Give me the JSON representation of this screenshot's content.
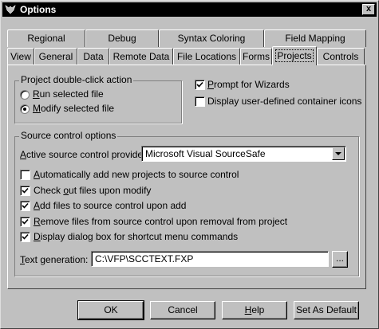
{
  "window": {
    "title": "Options",
    "close_glyph": "x"
  },
  "tabs_row1": [
    "Regional",
    "Debug",
    "Syntax Coloring",
    "Field Mapping"
  ],
  "tabs_row2": [
    "View",
    "General",
    "Data",
    "Remote Data",
    "File Locations",
    "Forms",
    "Projects",
    "Controls"
  ],
  "selected_tab": "Projects",
  "project_action": {
    "label": "Project double-click action",
    "option_run": "Run selected file",
    "option_modify": "Modify selected file",
    "selected": "Modify selected file"
  },
  "prompt_wizards": {
    "label": "Prompt for Wizards",
    "checked": true
  },
  "display_icons": {
    "label": "Display user-defined container icons",
    "checked": false
  },
  "source_control": {
    "label": "Source control options",
    "provider_label": "Active source control provider:",
    "provider_value": "Microsoft Visual SourceSafe",
    "auto_add": {
      "label": "Automatically add new projects to source control",
      "checked": false
    },
    "check_out": {
      "label": "Check out files upon modify",
      "checked": true
    },
    "add_files": {
      "label": "Add files to source control upon add",
      "checked": true
    },
    "remove_files": {
      "label": "Remove files from source control upon removal from project",
      "checked": true
    },
    "display_dialog": {
      "label": "Display dialog box for shortcut menu commands",
      "checked": true
    },
    "text_gen_label": "Text generation:",
    "text_gen_value": "C:\\VFP\\SCCTEXT.FXP",
    "browse_label": "..."
  },
  "buttons": {
    "ok": "OK",
    "cancel": "Cancel",
    "help": "Help",
    "set_default": "Set As Default"
  }
}
